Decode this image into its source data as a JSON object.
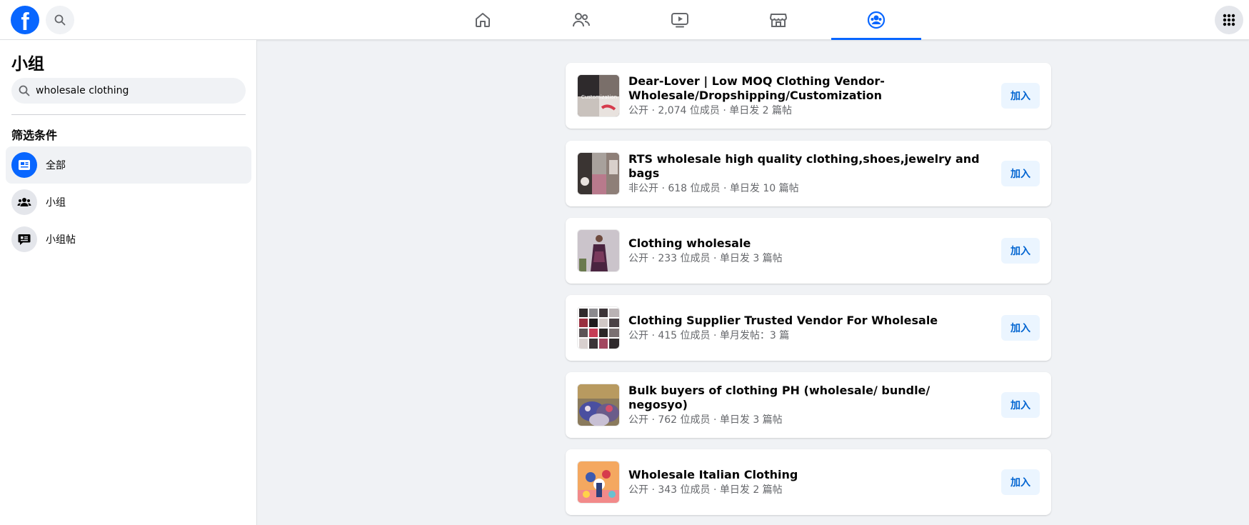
{
  "colors": {
    "brand": "#0866ff",
    "page_bg": "#f0f2f5",
    "join_bg": "#ebf5ff",
    "join_text": "#0064d1",
    "meta_text": "#65676b"
  },
  "header": {
    "logo_letter": "f",
    "nav_tabs": [
      {
        "icon": "home-icon",
        "active": false
      },
      {
        "icon": "friends-icon",
        "active": false
      },
      {
        "icon": "video-icon",
        "active": false
      },
      {
        "icon": "marketplace-icon",
        "active": false
      },
      {
        "icon": "groups-icon",
        "active": true
      }
    ]
  },
  "sidebar": {
    "title": "小组",
    "search_value": "wholesale clothing",
    "filters_title": "筛选条件",
    "filters": [
      {
        "label": "全部",
        "icon": "feed-icon",
        "active": true
      },
      {
        "label": "小组",
        "icon": "groups-icon",
        "active": false
      },
      {
        "label": "小组帖",
        "icon": "posts-icon",
        "active": false
      }
    ]
  },
  "results": [
    {
      "title": "Dear-Lover | Low MOQ Clothing Vendor-Wholesale/Dropshipping/Customization",
      "meta": "公开 · 2,074 位成员 · 单日发 2 篇帖",
      "thumb_text": "Customization",
      "join": "加入"
    },
    {
      "title": "RTS wholesale high quality clothing,shoes,jewelry and bags",
      "meta": "非公开 · 618 位成员 · 单日发 10 篇帖",
      "join": "加入"
    },
    {
      "title": "Clothing wholesale",
      "meta": "公开 · 233 位成员 · 单日发 3 篇帖",
      "join": "加入"
    },
    {
      "title": "Clothing Supplier Trusted Vendor For Wholesale",
      "meta": "公开 · 415 位成员 · 单月发帖：3 篇",
      "join": "加入"
    },
    {
      "title": "Bulk buyers of clothing PH (wholesale/ bundle/ negosyo)",
      "meta": "公开 · 762 位成员 · 单日发 3 篇帖",
      "join": "加入"
    },
    {
      "title": "Wholesale Italian Clothing",
      "meta": "公开 · 343 位成员 · 单日发 2 篇帖",
      "join": "加入"
    }
  ]
}
